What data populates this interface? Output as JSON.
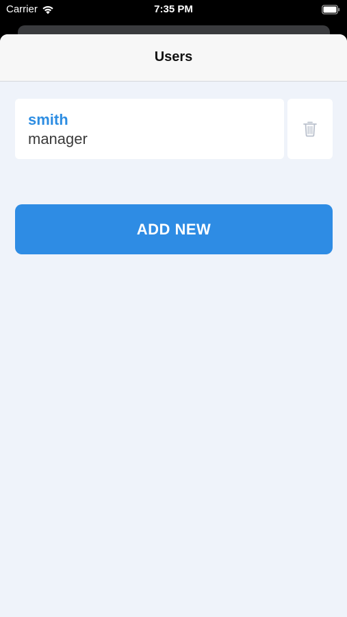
{
  "status_bar": {
    "carrier": "Carrier",
    "time": "7:35 PM",
    "icons": [
      "wifi-icon",
      "battery-icon"
    ]
  },
  "header": {
    "title": "Users"
  },
  "users": [
    {
      "name": "smith",
      "role": "manager"
    }
  ],
  "actions": {
    "add_new_label": "ADD NEW"
  },
  "colors": {
    "accent": "#2e8ce4",
    "name_text": "#2d8de2",
    "background": "#eff3fa",
    "card": "#ffffff",
    "trash_icon": "#b9c0cc"
  }
}
